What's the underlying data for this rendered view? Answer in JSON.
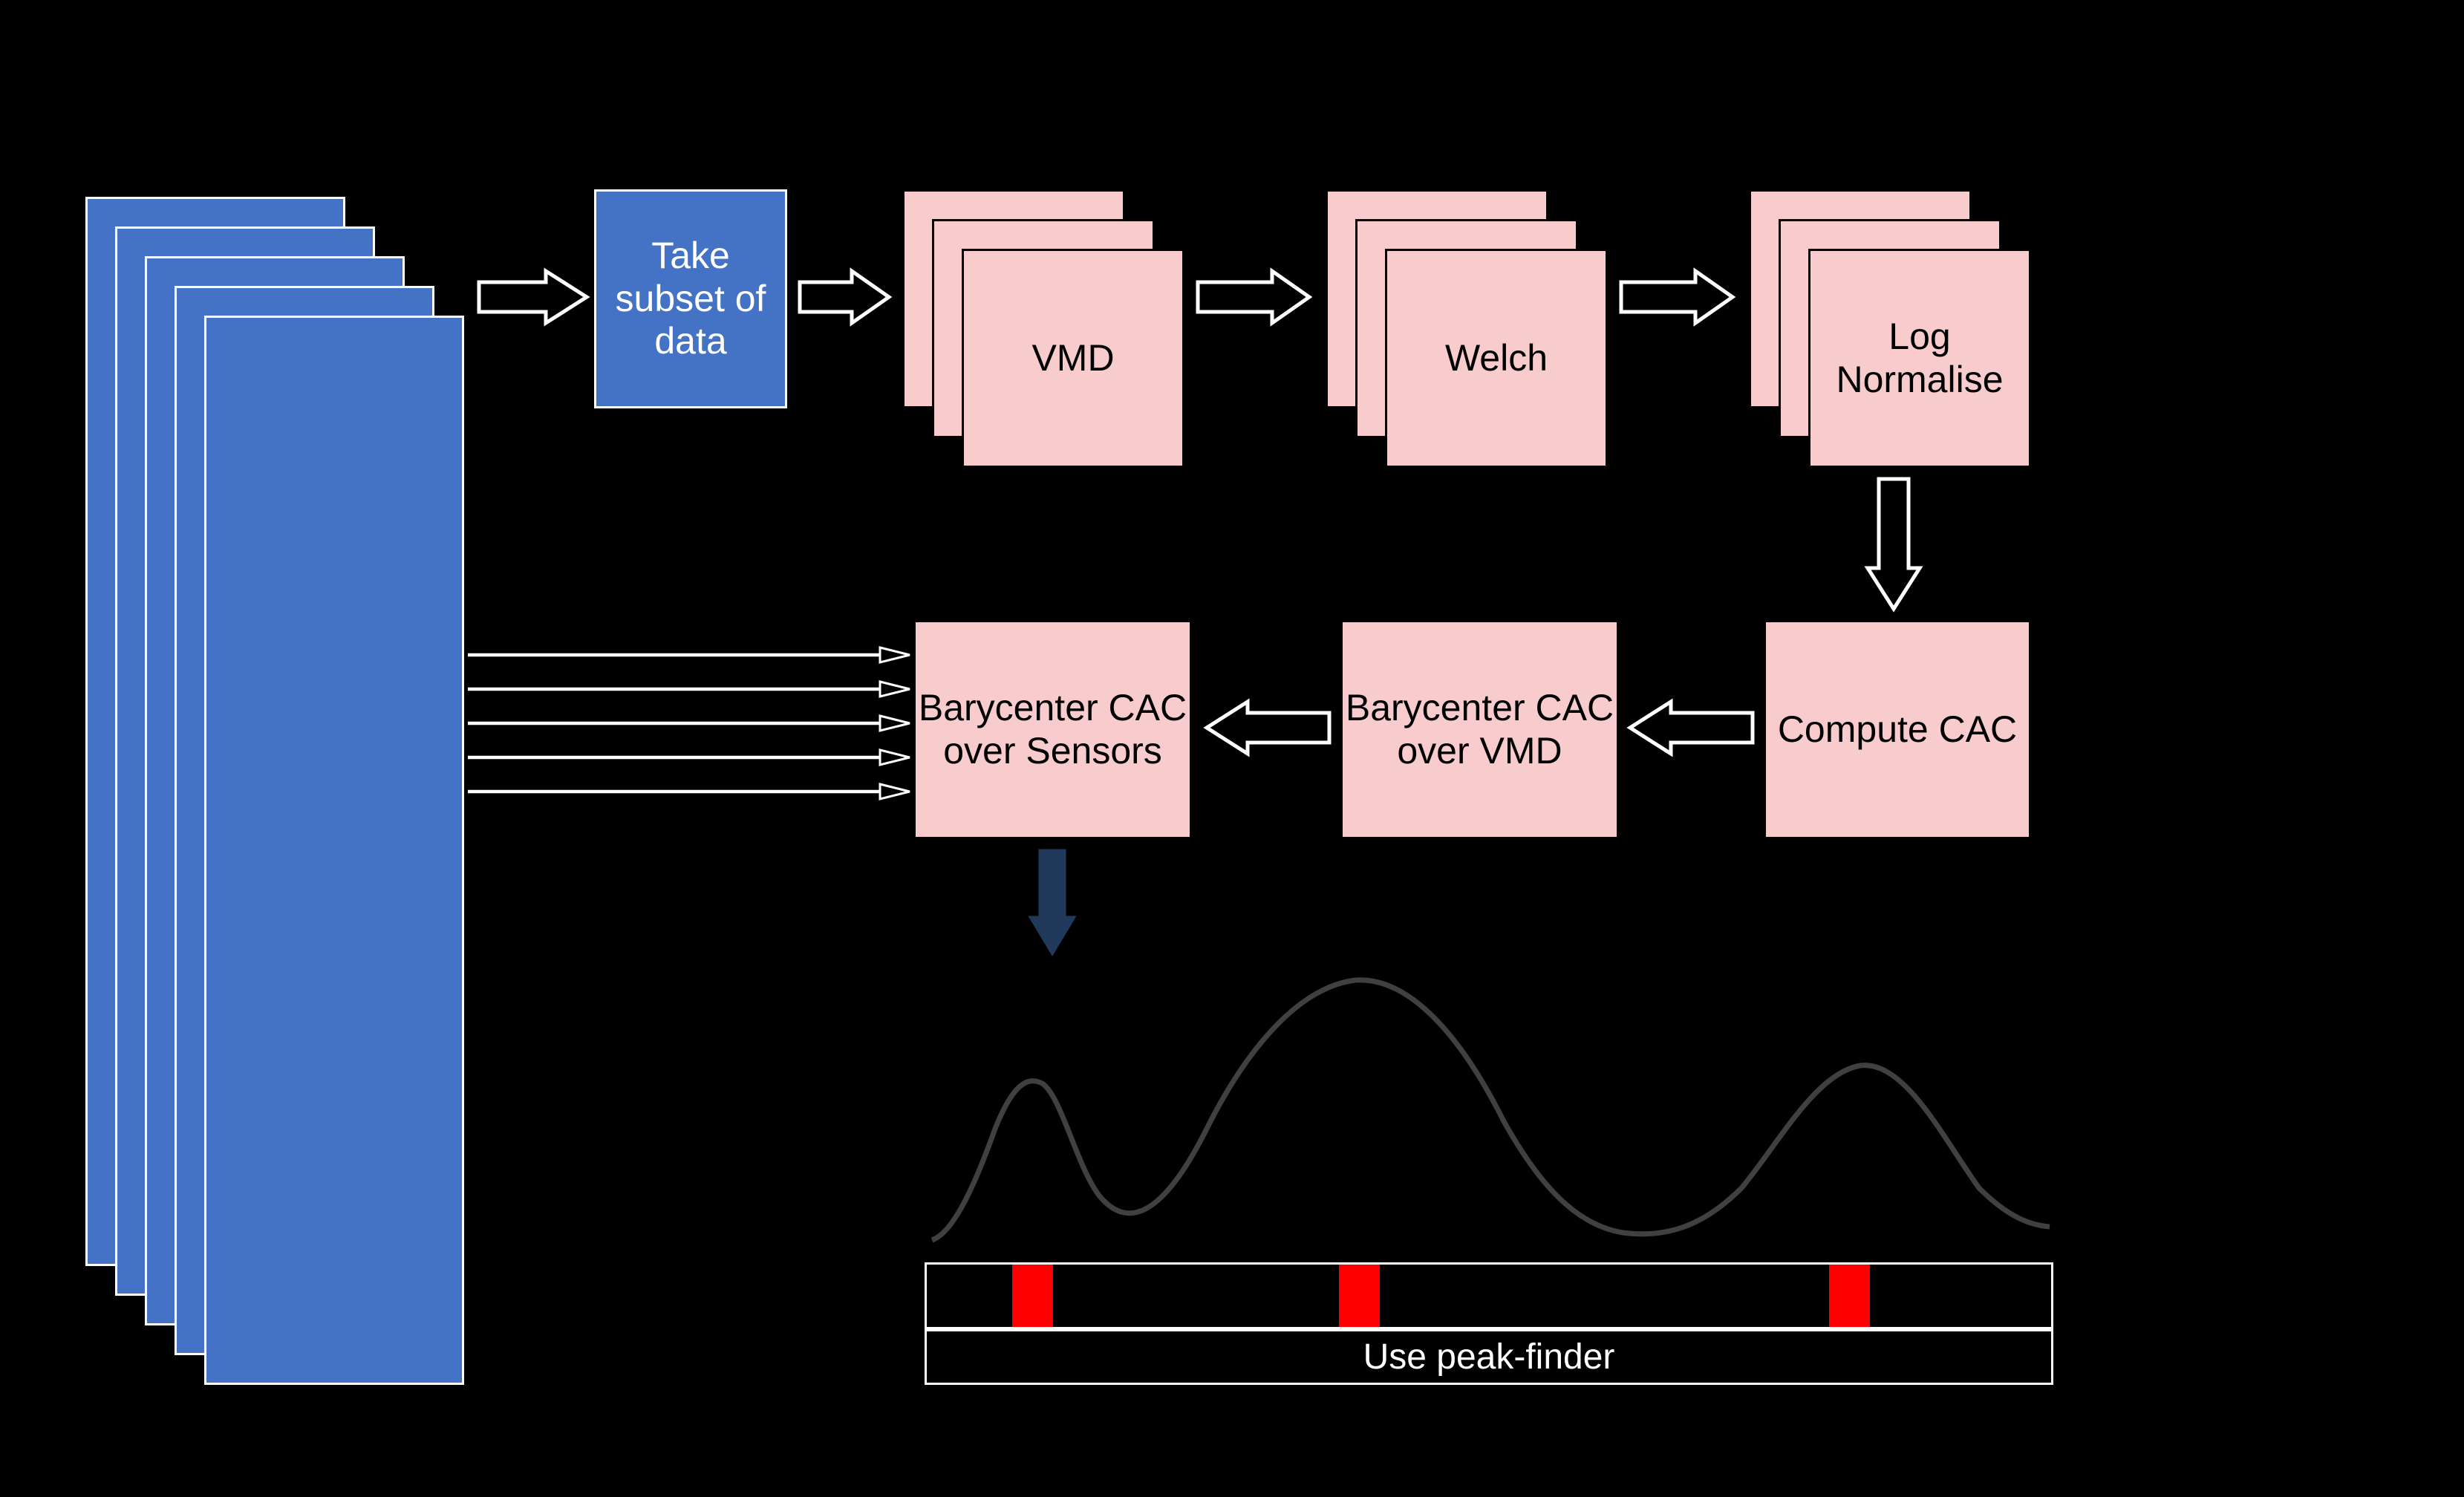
{
  "boxes": {
    "take_subset": "Take subset of data",
    "vmd": "VMD",
    "welch": "Welch",
    "log_normalise": "Log Normalise",
    "compute_cac": "Compute CAC",
    "barycenter_vmd": "Barycenter CAC over VMD",
    "barycenter_sensors": "Barycenter CAC over Sensors"
  },
  "peak_finder_label": "Use peak-finder",
  "colors": {
    "blue": "#4472C4",
    "pink": "#F8CBCC",
    "red": "#fe0000",
    "dark_arrow": "#213a5c"
  }
}
